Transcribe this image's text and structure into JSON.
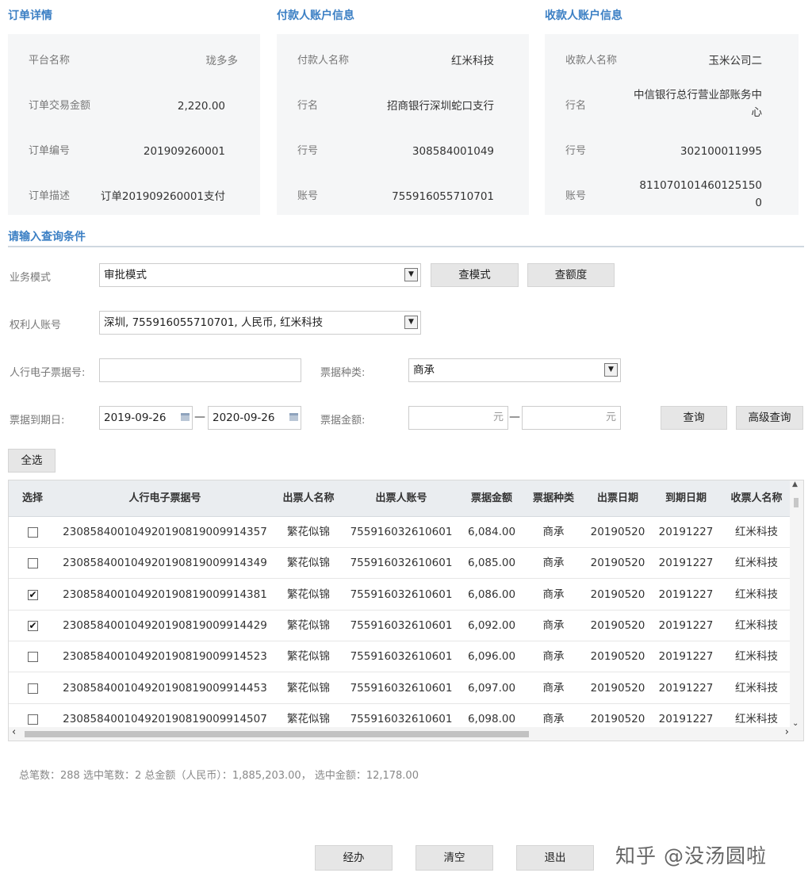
{
  "order_section": {
    "title": "订单详情",
    "items": [
      {
        "label": "平台名称",
        "value": "珑多多"
      },
      {
        "label": "订单交易金额",
        "value": "2,220.00"
      },
      {
        "label": "订单编号",
        "value": "201909260001"
      },
      {
        "label": "订单描述",
        "value": "订单201909260001支付"
      }
    ]
  },
  "payer_section": {
    "title": "付款人账户信息",
    "items": [
      {
        "label": "付款人名称",
        "value": "红米科技"
      },
      {
        "label": "行名",
        "value": "招商银行深圳蛇口支行"
      },
      {
        "label": "行号",
        "value": "308584001049"
      },
      {
        "label": "账号",
        "value": "755916055710701"
      }
    ]
  },
  "payee_section": {
    "title": "收款人账户信息",
    "items": [
      {
        "label": "收款人名称",
        "value": "玉米公司二"
      },
      {
        "label": "行名",
        "value": "中信银行总行营业部账务中心"
      },
      {
        "label": "行号",
        "value": "302100011995"
      },
      {
        "label": "账号",
        "value": "8110701014601251500"
      }
    ]
  },
  "query": {
    "title": "请输入查询条件",
    "business_mode_label": "业务模式",
    "business_mode_value": "审批模式",
    "btn_check_mode": "查模式",
    "btn_check_quota": "查额度",
    "account_label": "权利人账号",
    "account_value": "深圳, 755916055710701, 人民币, 红米科技",
    "ebill_label": "人行电子票据号:",
    "ebill_value": "",
    "bill_type_label": "票据种类:",
    "bill_type_value": "商承",
    "due_date_label": "票据到期日:",
    "due_date_from": "2019-09-26",
    "due_date_to": "2020-09-26",
    "amount_label": "票据金额:",
    "amount_unit": "元",
    "dash": "—",
    "btn_query": "查询",
    "btn_advanced": "高级查询",
    "btn_select_all": "全选"
  },
  "table": {
    "headers": [
      "选择",
      "人行电子票据号",
      "出票人名称",
      "出票人账号",
      "票据金额",
      "票据种类",
      "出票日期",
      "到期日期",
      "收票人名称"
    ],
    "rows": [
      {
        "checked": false,
        "bill_no": "230858400104920190819009914357",
        "drawer": "繁花似锦",
        "account": "755916032610601",
        "amount": "6,084.00",
        "type": "商承",
        "issue": "20190520",
        "due": "20191227",
        "payee": "红米科技"
      },
      {
        "checked": false,
        "bill_no": "230858400104920190819009914349",
        "drawer": "繁花似锦",
        "account": "755916032610601",
        "amount": "6,085.00",
        "type": "商承",
        "issue": "20190520",
        "due": "20191227",
        "payee": "红米科技"
      },
      {
        "checked": true,
        "bill_no": "230858400104920190819009914381",
        "drawer": "繁花似锦",
        "account": "755916032610601",
        "amount": "6,086.00",
        "type": "商承",
        "issue": "20190520",
        "due": "20191227",
        "payee": "红米科技"
      },
      {
        "checked": true,
        "bill_no": "230858400104920190819009914429",
        "drawer": "繁花似锦",
        "account": "755916032610601",
        "amount": "6,092.00",
        "type": "商承",
        "issue": "20190520",
        "due": "20191227",
        "payee": "红米科技"
      },
      {
        "checked": false,
        "bill_no": "230858400104920190819009914523",
        "drawer": "繁花似锦",
        "account": "755916032610601",
        "amount": "6,096.00",
        "type": "商承",
        "issue": "20190520",
        "due": "20191227",
        "payee": "红米科技"
      },
      {
        "checked": false,
        "bill_no": "230858400104920190819009914453",
        "drawer": "繁花似锦",
        "account": "755916032610601",
        "amount": "6,097.00",
        "type": "商承",
        "issue": "20190520",
        "due": "20191227",
        "payee": "红米科技"
      },
      {
        "checked": false,
        "bill_no": "230858400104920190819009914507",
        "drawer": "繁花似锦",
        "account": "755916032610601",
        "amount": "6,098.00",
        "type": "商承",
        "issue": "20190520",
        "due": "20191227",
        "payee": "红米科技"
      }
    ]
  },
  "summary": "总笔数：288 选中笔数：2 总金额（人民币）：1,885,203.00， 选中金额：12,178.00",
  "footer": {
    "btn_process": "经办",
    "btn_clear": "清空",
    "btn_exit": "退出"
  },
  "watermark": "知乎 @没汤圆啦",
  "icons": {
    "dropdown": "chevron-down-icon",
    "calendar": "calendar-icon",
    "checkmark": "✔"
  }
}
